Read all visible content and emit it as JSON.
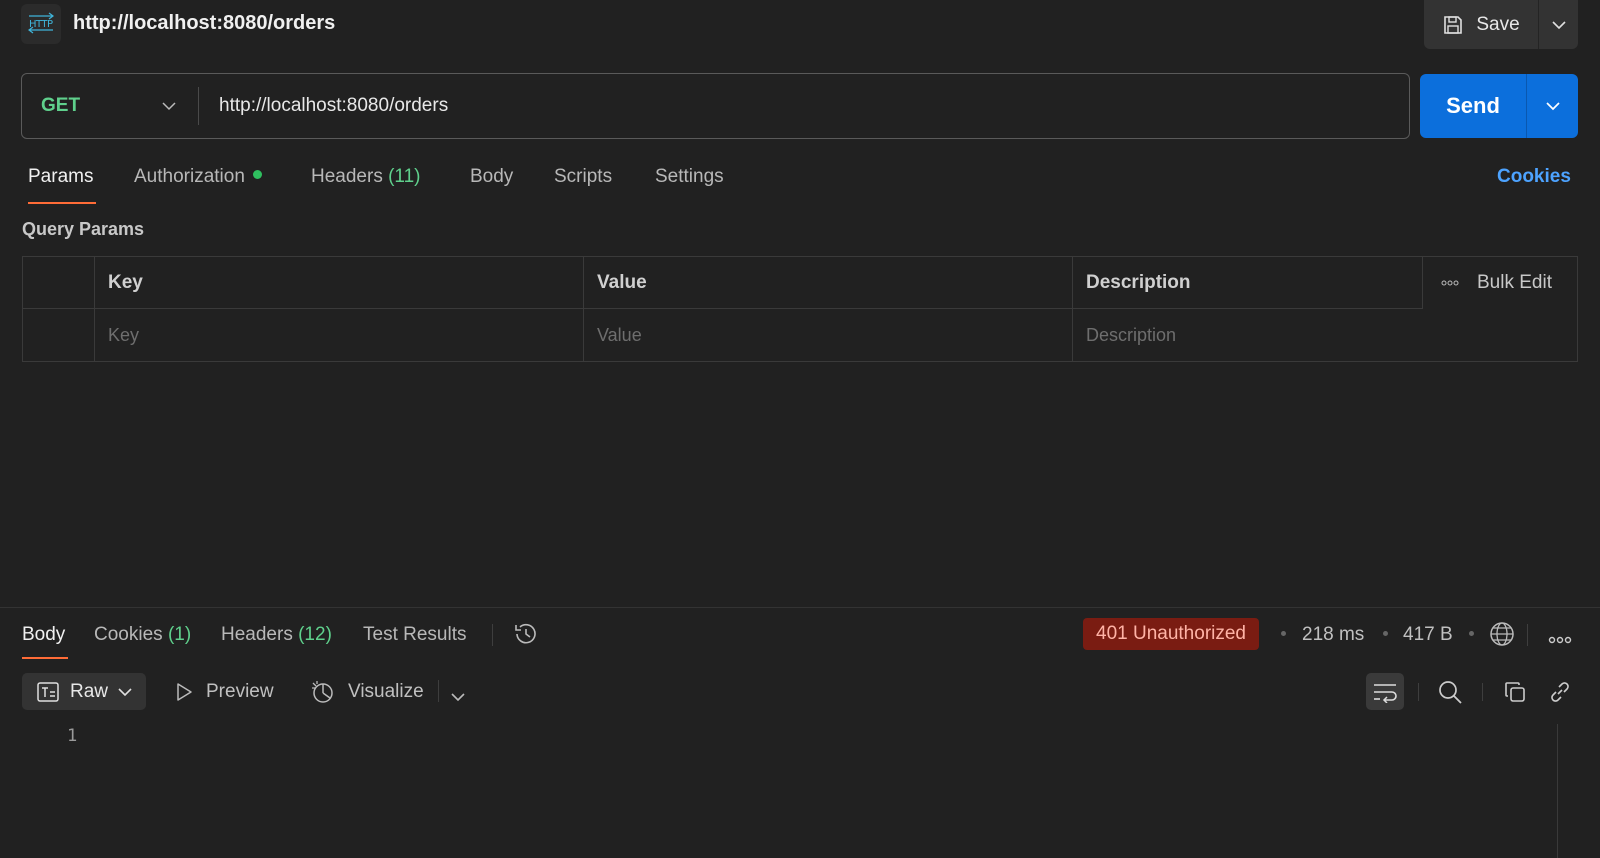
{
  "header": {
    "request_title": "http://localhost:8080/orders",
    "save_label": "Save"
  },
  "request": {
    "method": "GET",
    "url": "http://localhost:8080/orders",
    "send_label": "Send"
  },
  "tabs": {
    "params": "Params",
    "authorization": "Authorization",
    "headers": "Headers",
    "headers_count": "(11)",
    "body": "Body",
    "scripts": "Scripts",
    "settings": "Settings",
    "cookies_link": "Cookies"
  },
  "query_params": {
    "title": "Query Params",
    "columns": {
      "key": "Key",
      "value": "Value",
      "description": "Description"
    },
    "bulk_edit": "Bulk Edit",
    "placeholders": {
      "key": "Key",
      "value": "Value",
      "description": "Description"
    }
  },
  "response": {
    "tabs": {
      "body": "Body",
      "cookies": "Cookies",
      "cookies_count": "(1)",
      "headers": "Headers",
      "headers_count": "(12)",
      "test_results": "Test Results"
    },
    "status": "401 Unauthorized",
    "time": "218 ms",
    "size": "417 B",
    "format": "Raw",
    "preview": "Preview",
    "visualize": "Visualize",
    "line_numbers": [
      "1"
    ]
  },
  "colors": {
    "accent": "#ff6c37",
    "send": "#0c6fdc",
    "method_get": "#5fd08c",
    "status_error": "#7a1c12",
    "link": "#4da3ff"
  }
}
